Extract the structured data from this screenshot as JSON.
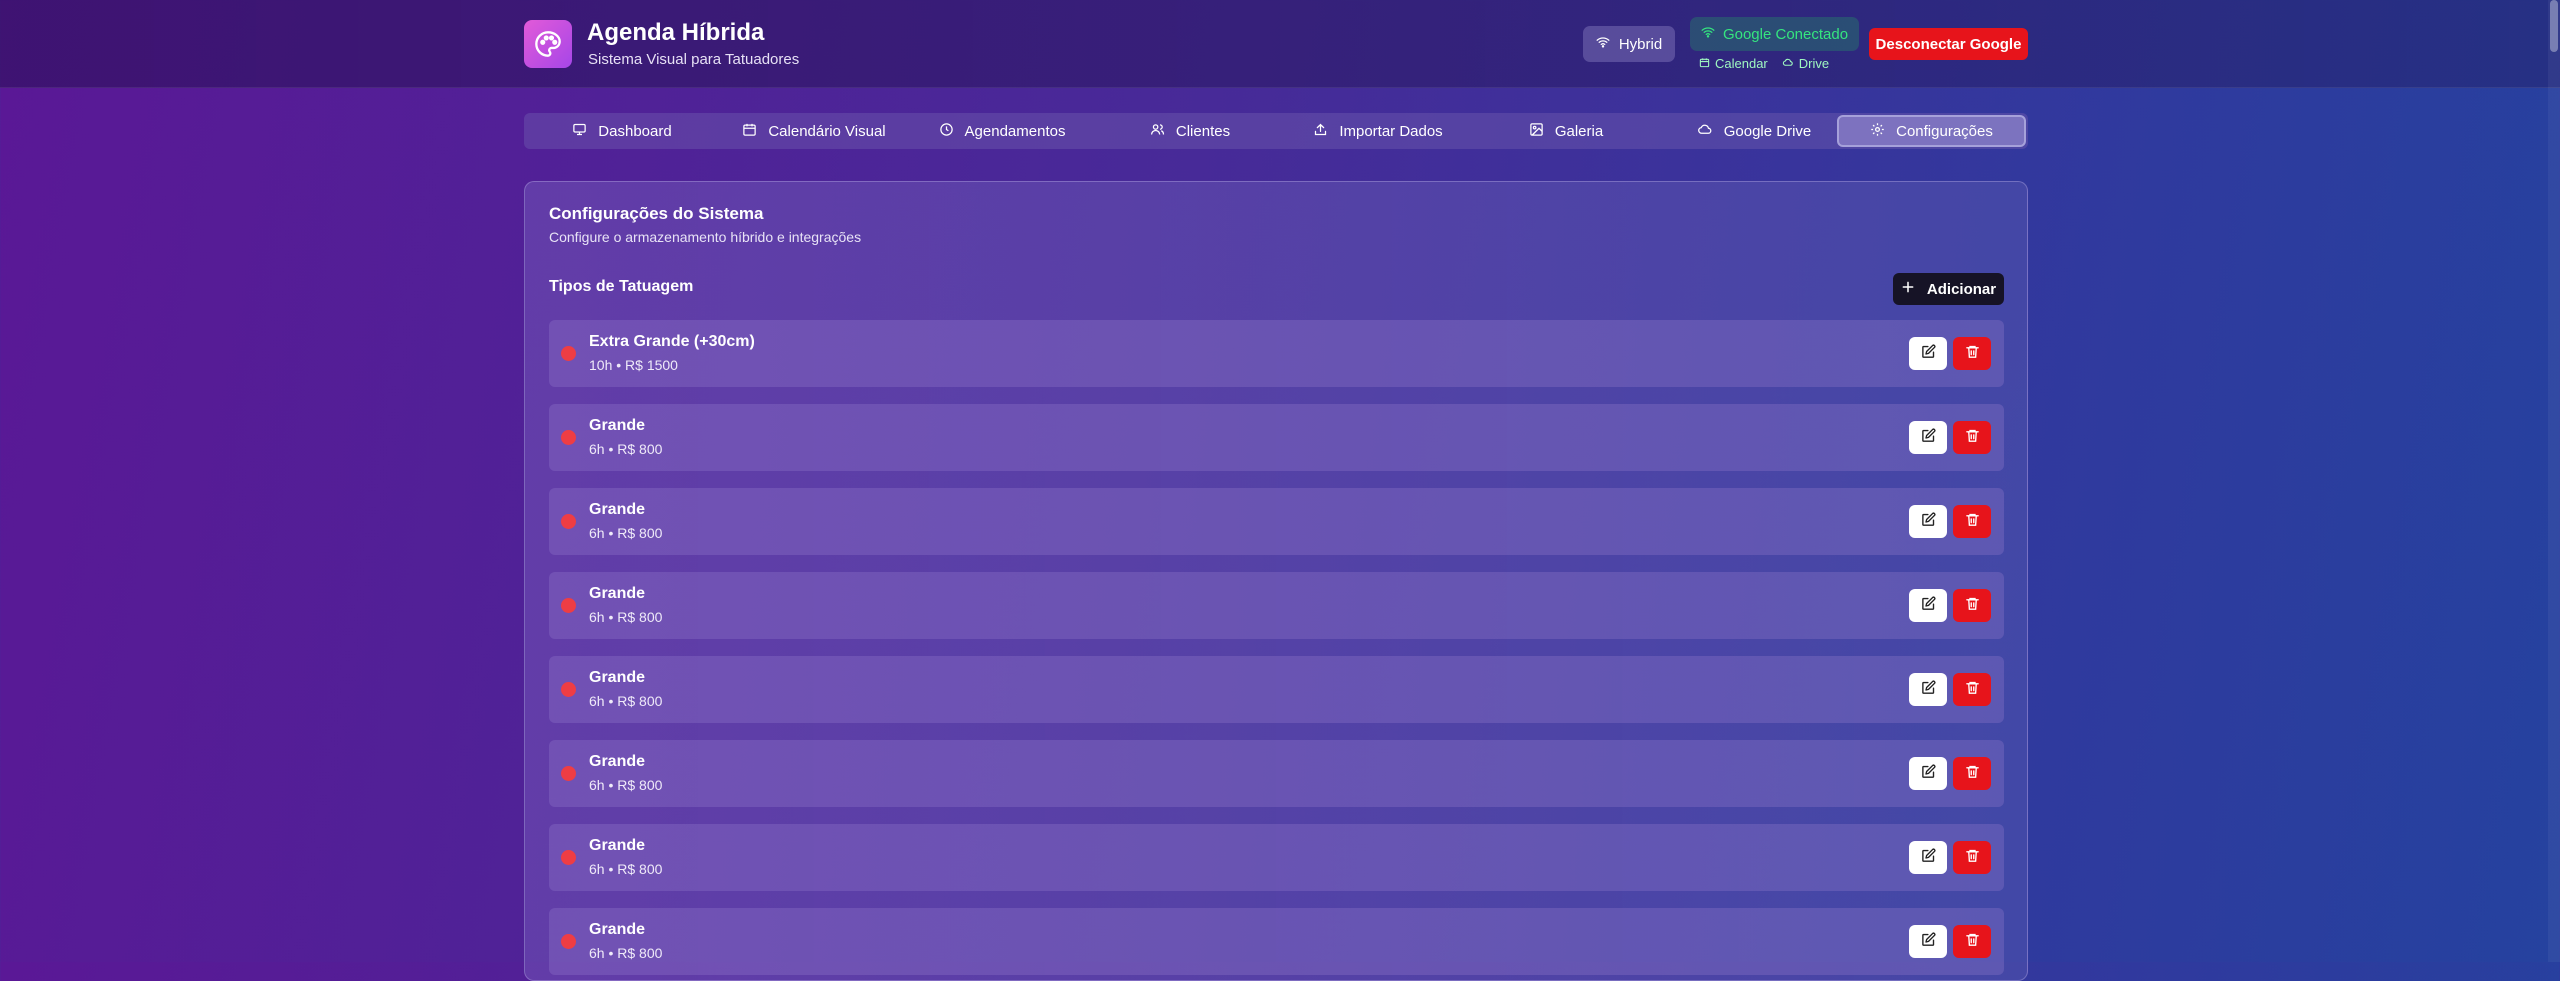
{
  "header": {
    "title": "Agenda Híbrida",
    "subtitle": "Sistema Visual para Tatuadores",
    "hybrid_label": "Hybrid",
    "google_status": "Google Conectado",
    "google_calendar": "Calendar",
    "google_drive": "Drive",
    "disconnect_label": "Desconectar Google"
  },
  "tabs": [
    {
      "label": "Dashboard",
      "icon": "monitor-icon"
    },
    {
      "label": "Calendário Visual",
      "icon": "calendar-icon"
    },
    {
      "label": "Agendamentos",
      "icon": "clock-icon"
    },
    {
      "label": "Clientes",
      "icon": "users-icon"
    },
    {
      "label": "Importar Dados",
      "icon": "upload-icon"
    },
    {
      "label": "Galeria",
      "icon": "image-icon"
    },
    {
      "label": "Google Drive",
      "icon": "cloud-icon"
    },
    {
      "label": "Configurações",
      "icon": "gear-icon",
      "active": true
    }
  ],
  "settings": {
    "title": "Configurações do Sistema",
    "description": "Configure o armazenamento híbrido e integrações",
    "section_title": "Tipos de Tatuagem",
    "add_label": "Adicionar",
    "items": [
      {
        "name": "Extra Grande (+30cm)",
        "meta": "10h • R$ 1500"
      },
      {
        "name": "Grande",
        "meta": "6h • R$ 800"
      },
      {
        "name": "Grande",
        "meta": "6h • R$ 800"
      },
      {
        "name": "Grande",
        "meta": "6h • R$ 800"
      },
      {
        "name": "Grande",
        "meta": "6h • R$ 800"
      },
      {
        "name": "Grande",
        "meta": "6h • R$ 800"
      },
      {
        "name": "Grande",
        "meta": "6h • R$ 800"
      },
      {
        "name": "Grande",
        "meta": "6h • R$ 800"
      }
    ]
  },
  "colors": {
    "danger": "#e7141b",
    "dot": "#ee3d44",
    "connected": "#35e57f"
  }
}
